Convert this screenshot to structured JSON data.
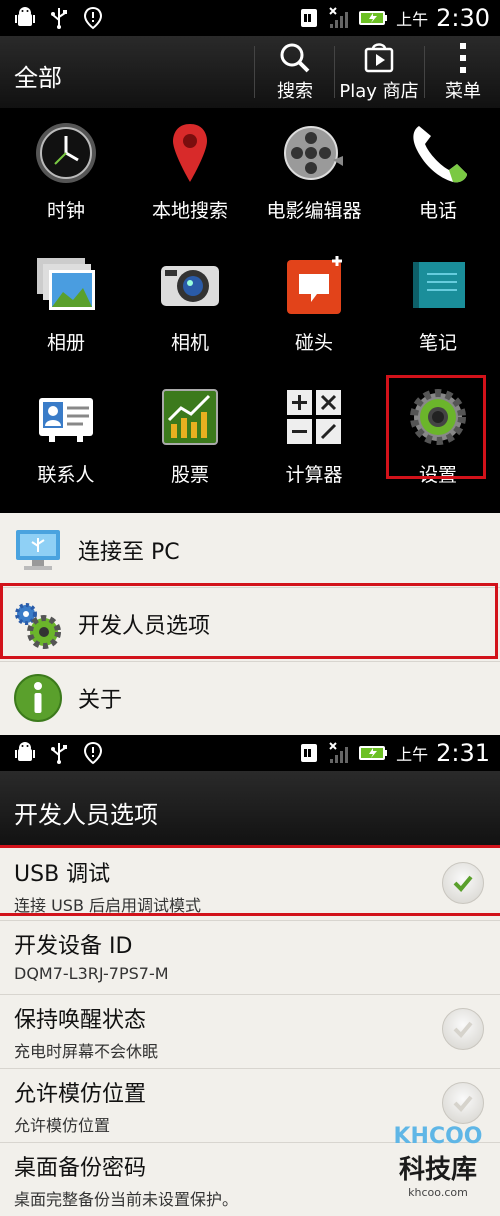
{
  "screen1": {
    "status": {
      "ampm": "上午",
      "time": "2:30"
    },
    "action_bar": {
      "title": "全部",
      "search_label": "搜索",
      "play_label": "Play 商店",
      "menu_label": "菜单"
    },
    "apps": [
      {
        "label": "时钟"
      },
      {
        "label": "本地搜索"
      },
      {
        "label": "电影编辑器"
      },
      {
        "label": "电话"
      },
      {
        "label": "相册"
      },
      {
        "label": "相机"
      },
      {
        "label": "碰头"
      },
      {
        "label": "笔记"
      },
      {
        "label": "联系人"
      },
      {
        "label": "股票"
      },
      {
        "label": "计算器"
      },
      {
        "label": "设置"
      }
    ]
  },
  "settings_list": [
    {
      "label": "连接至 PC"
    },
    {
      "label": "开发人员选项"
    },
    {
      "label": "关于"
    }
  ],
  "screen2": {
    "status": {
      "ampm": "上午",
      "time": "2:31"
    },
    "title": "开发人员选项",
    "options": [
      {
        "title": "USB 调试",
        "subtitle": "连接 USB 后启用调试模式",
        "checked": true
      },
      {
        "title": "开发设备 ID",
        "subtitle": "DQM7-L3RJ-7PS7-M"
      },
      {
        "title": "保持唤醒状态",
        "subtitle": "充电时屏幕不会休眠",
        "checked": false
      },
      {
        "title": "允许模仿位置",
        "subtitle": "允许模仿位置",
        "checked": false
      },
      {
        "title": "桌面备份密码",
        "subtitle": "桌面完整备份当前未设置保护。"
      }
    ]
  },
  "watermark": {
    "logo": "KHCOO",
    "name": "科技库",
    "url": "khcoo.com"
  },
  "colors": {
    "highlight": "#d2121a",
    "list_bg": "#f2f0eb",
    "check_green": "#5aa02c"
  }
}
